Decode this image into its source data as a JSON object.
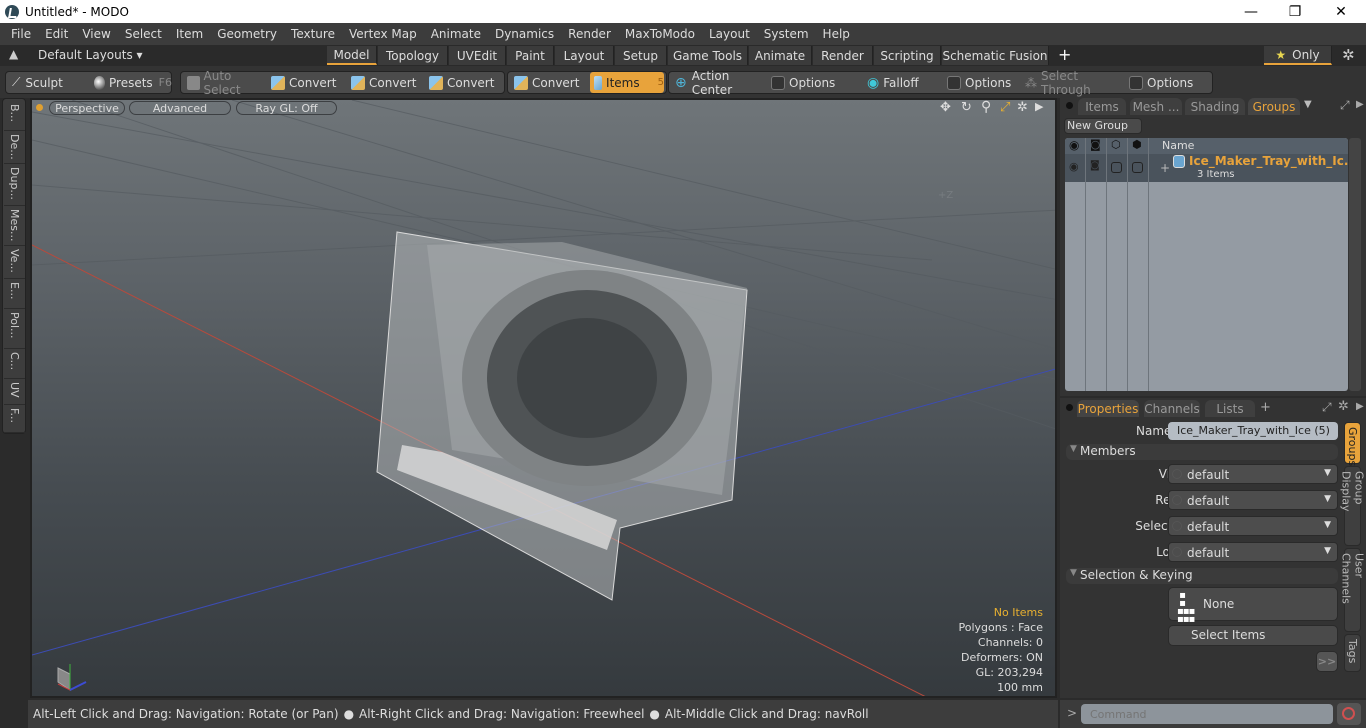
{
  "window": {
    "title": "Untitled* - MODO",
    "min": "—",
    "max": "❐",
    "close": "✕"
  },
  "menu": [
    "File",
    "Edit",
    "View",
    "Select",
    "Item",
    "Geometry",
    "Texture",
    "Vertex Map",
    "Animate",
    "Dynamics",
    "Render",
    "MaxToModo",
    "Layout",
    "System",
    "Help"
  ],
  "layouts": {
    "dropdown": "Default Layouts ▾",
    "tabs": [
      "Model",
      "Topology",
      "UVEdit",
      "Paint",
      "Layout",
      "Setup",
      "Game Tools",
      "Animate",
      "Render",
      "Scripting",
      "Schematic Fusion"
    ],
    "active_tab": "Model",
    "add": "+",
    "only": "Only",
    "star": "★"
  },
  "toolbar": {
    "sculpt": "Sculpt",
    "presets": "Presets",
    "presets_key": "F6",
    "auto_select": "Auto Select",
    "convert1": "Convert",
    "convert2": "Convert",
    "convert3": "Convert",
    "convert4": "Convert",
    "items": "Items",
    "items_key": "5",
    "action_center": "Action Center",
    "options1": "Options",
    "falloff": "Falloff",
    "options2": "Options",
    "select_through": "Select Through",
    "options3": "Options"
  },
  "side_tabs": [
    "B...",
    "De...",
    "Dup...",
    "Mes...",
    "Ve...",
    "E...",
    "Pol...",
    "C...",
    "UV",
    "F..."
  ],
  "viewport": {
    "view": "Perspective",
    "shading": "Advanced",
    "raygl": "Ray GL: Off",
    "axis_label": "+Z",
    "info": {
      "selection": "No Items",
      "polygons": "Polygons : Face",
      "channels": "Channels: 0",
      "deformers": "Deformers: ON",
      "gl": "GL: 203,294",
      "scale": "100 mm"
    },
    "highlight_color": "#e8b030"
  },
  "groups_panel": {
    "tabs": [
      "Items",
      "Mesh ...",
      "Shading",
      "Groups"
    ],
    "active_tab": "Groups",
    "new_group": "New Group",
    "column_name": "Name",
    "rows": [
      {
        "name": "Ice_Maker_Tray_with_Ic...",
        "sub": "3 Items"
      }
    ]
  },
  "properties_panel": {
    "tabs": [
      "Properties",
      "Channels",
      "Lists"
    ],
    "active_tab": "Properties",
    "add": "+",
    "name_label": "Name",
    "name_value": "Ice_Maker_Tray_with_Ice (5)",
    "members_header": "Members",
    "fields": [
      {
        "label": "Visible",
        "value": "default"
      },
      {
        "label": "Render",
        "value": "default"
      },
      {
        "label": "Selectable",
        "value": "default"
      },
      {
        "label": "Locked",
        "value": "default"
      }
    ],
    "selection_header": "Selection & Keying",
    "none_label": "None",
    "select_items": "Select Items",
    "more": ">>",
    "side_tabs": [
      "Groups",
      "Group Display",
      "User Channels",
      "Tags"
    ]
  },
  "statusbar": {
    "hint1": "Alt-Left Click and Drag: Navigation: Rotate (or Pan)",
    "hint2": "Alt-Right Click and Drag: Navigation: Freewheel",
    "hint3": "Alt-Middle Click and Drag: navRoll"
  },
  "command": {
    "prompt": ">",
    "placeholder": "Command"
  },
  "accent_color": "#e8a33b"
}
